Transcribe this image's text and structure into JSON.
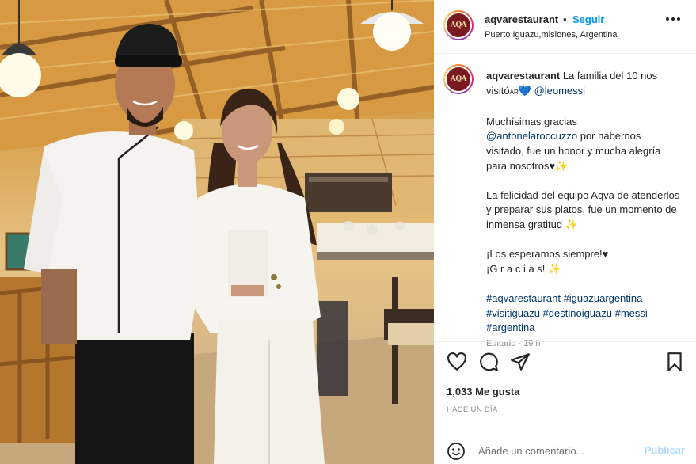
{
  "post": {
    "username": "aqvarestaurant",
    "dot": "•",
    "follow_label": "Seguir",
    "location": "Puerto Iguazu,misiones, Argentina",
    "avatar_text": "AQA"
  },
  "caption": {
    "username": "aqvarestaurant",
    "line1_text": " La familia del 10 nos visitó",
    "line1_small": "AR",
    "line1_heart": "💙",
    "mention1": "@leomessi",
    "para2_a": "Muchísimas gracias",
    "mention2": "@antonelaroccuzzo",
    "para2_b": " por habernos visitado, fue un honor y mucha alegría para nosotros♥✨",
    "para3": "La felicidad del equipo Aqva de atenderlos y preparar sus platos, fue un momento de inmensa gratitud ✨",
    "para4_a": "¡Los esperamos siempre!♥",
    "para4_b": "¡G r a c i a s! ✨",
    "hashtags": "#aqvarestaurant #iguazuargentina #visitiguazu #destinoiguazu #messi #argentina",
    "edited": "Editado · 19 h"
  },
  "actions": {
    "likes": "1,033 Me gusta",
    "time_ago": "HACE UN DÍA",
    "comment_placeholder": "Añade un comentario...",
    "publish_label": "Publicar"
  },
  "colors": {
    "link": "#0095f6",
    "mention": "#00376b",
    "publish_disabled": "#b3dbff",
    "brand_logo": "#7a1a20"
  },
  "icons": [
    "heart-icon",
    "comment-icon",
    "share-icon",
    "bookmark-icon",
    "more-options-icon",
    "emoji-icon"
  ]
}
